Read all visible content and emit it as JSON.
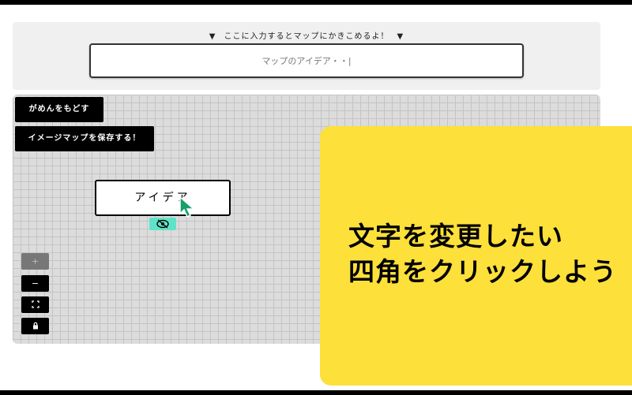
{
  "input_panel": {
    "instruction": "ここに入力するとマップにかきこめるよ！",
    "arrow_left": "▼",
    "arrow_right": "▼",
    "placeholder": "マップのアイデア・・|"
  },
  "canvas": {
    "reset_label": "がめんをもどす",
    "save_label": "イメージマップを保存する！",
    "node_label": "アイデア",
    "zoom_controls": [
      {
        "label": "+",
        "icon": "plus-icon",
        "enabled": false
      },
      {
        "label": "−",
        "icon": "minus-icon",
        "enabled": true
      },
      {
        "label": "⛶",
        "icon": "fit-view-icon",
        "enabled": true
      },
      {
        "label": "🔒",
        "icon": "lock-icon",
        "enabled": true
      }
    ]
  },
  "overlay": {
    "line1": "文字を変更したい",
    "line2": "四角をクリックしよう"
  },
  "colors": {
    "overlay_bg": "#fde03a",
    "eye_button": "#5fe3c8",
    "cursor": "#16a06a"
  }
}
